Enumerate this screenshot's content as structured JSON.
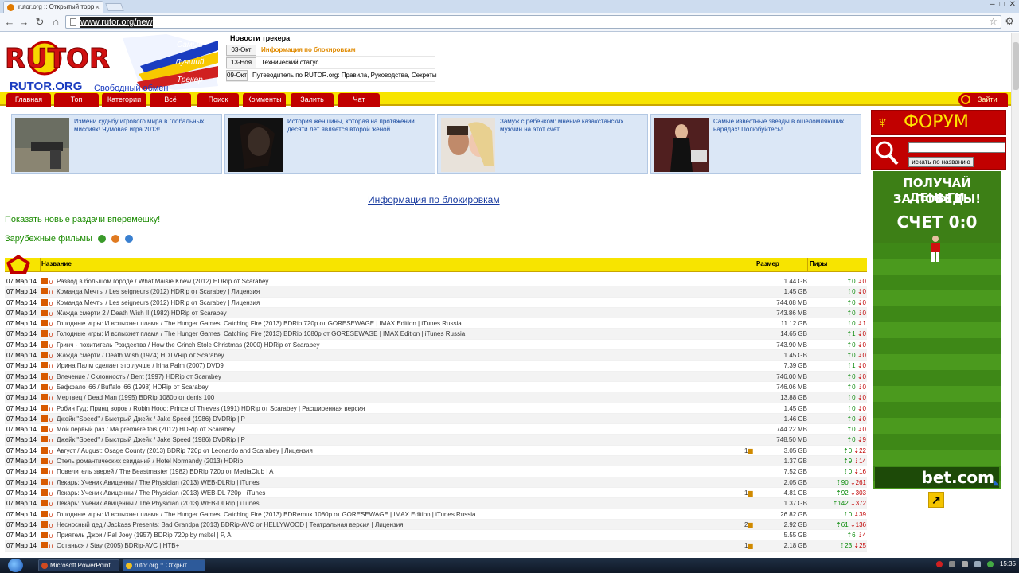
{
  "browser": {
    "tab_title": "rutor.org :: Открытый торр",
    "url": "www.rutor.org/new"
  },
  "logo": {
    "letters": "RUTOR",
    "domain": "RUTOR.ORG",
    "slogan": "Свободный обмен",
    "flag_words": [
      "Самый",
      "Лучший",
      "Трекер"
    ]
  },
  "news": {
    "title": "Новости трекера",
    "items": [
      {
        "date": "03-Окт",
        "text": "Информация по блокировкам",
        "highlight": true
      },
      {
        "date": "13-Ноя",
        "text": "Технический статус",
        "highlight": false
      },
      {
        "date": "09-Окт",
        "text": "Путеводитель по RUTOR.org: Правила, Руководства, Секреты",
        "highlight": false
      }
    ]
  },
  "menu": {
    "items": [
      "Главная",
      "Топ",
      "Категории",
      "Всё",
      "Поиск",
      "Комменты",
      "Залить",
      "Чат"
    ],
    "login": "Зайти"
  },
  "ads": [
    {
      "text": "Измени судьбу игрового мира в глобальных миссиях! Чумовая игра 2013!"
    },
    {
      "text": "История женщины, которая на протяжении десяти лет является второй женой"
    },
    {
      "text": "Замуж с ребенком: мнение казахстанских мужчин на этот счет"
    },
    {
      "text": "Самые известные звёзды в ошеломляющих нарядах! Полюбуйтесь!"
    }
  ],
  "blocking_link": "Информация по блокировкам",
  "show_new": "Показать новые раздачи вперемешку!",
  "section_title": "Зарубежные фильмы",
  "table": {
    "headers": {
      "name": "Название",
      "size": "Размер",
      "peers": "Пиры"
    },
    "rows": [
      {
        "date": "07 Мар 14",
        "title": "Развод в большом городе / What Maisie Knew (2012) HDRip от Scarabey",
        "comments": "",
        "size": "1.44 GB",
        "up": "0",
        "down": "0"
      },
      {
        "date": "07 Мар 14",
        "title": "Команда Мечты / Les seigneurs (2012) HDRip от Scarabey | Лицензия",
        "comments": "",
        "size": "1.45 GB",
        "up": "0",
        "down": "0"
      },
      {
        "date": "07 Мар 14",
        "title": "Команда Мечты / Les seigneurs (2012) HDRip от Scarabey | Лицензия",
        "comments": "",
        "size": "744.08 MB",
        "up": "0",
        "down": "0"
      },
      {
        "date": "07 Мар 14",
        "title": "Жажда смерти 2 / Death Wish II (1982) HDRip от Scarabey",
        "comments": "",
        "size": "743.86 MB",
        "up": "0",
        "down": "0"
      },
      {
        "date": "07 Мар 14",
        "title": "Голодные игры: И вспыхнет пламя / The Hunger Games: Catching Fire (2013) BDRip 720p от GORESEWAGE | IMAX Edition | iTunes Russia",
        "comments": "",
        "size": "11.12 GB",
        "up": "0",
        "down": "1"
      },
      {
        "date": "07 Мар 14",
        "title": "Голодные игры: И вспыхнет пламя / The Hunger Games: Catching Fire (2013) BDRip 1080p от GORESEWAGE | IMAX Edition | iTunes Russia",
        "comments": "",
        "size": "14.65 GB",
        "up": "1",
        "down": "0"
      },
      {
        "date": "07 Мар 14",
        "title": "Гринч - похититель Рождества / How the Grinch Stole Christmas (2000) HDRip от Scarabey",
        "comments": "",
        "size": "743.90 MB",
        "up": "0",
        "down": "0"
      },
      {
        "date": "07 Мар 14",
        "title": "Жажда смерти / Death Wish (1974) HDTVRip от Scarabey",
        "comments": "",
        "size": "1.45 GB",
        "up": "0",
        "down": "0"
      },
      {
        "date": "07 Мар 14",
        "title": "Ирина Палм сделает это лучше / Irina Palm (2007) DVD9",
        "comments": "",
        "size": "7.39 GB",
        "up": "1",
        "down": "0"
      },
      {
        "date": "07 Мар 14",
        "title": "Влечение / Склонность / Bent (1997) HDRip от Scarabey",
        "comments": "",
        "size": "746.00 MB",
        "up": "0",
        "down": "0"
      },
      {
        "date": "07 Мар 14",
        "title": "Баффало '66 / Buffalo '66 (1998) HDRip от Scarabey",
        "comments": "",
        "size": "746.06 MB",
        "up": "0",
        "down": "0"
      },
      {
        "date": "07 Мар 14",
        "title": "Мертвец / Dead Man (1995) BDRip 1080p от denis 100",
        "comments": "",
        "size": "13.88 GB",
        "up": "0",
        "down": "0"
      },
      {
        "date": "07 Мар 14",
        "title": "Робин Гуд: Принц воров / Robin Hood: Prince of Thieves (1991) HDRip от Scarabey | Расширенная версия",
        "comments": "",
        "size": "1.45 GB",
        "up": "0",
        "down": "0"
      },
      {
        "date": "07 Мар 14",
        "title": "Джейк \"Speed\" / Быстрый Джейк / Jake Speed (1986) DVDRip | P",
        "comments": "",
        "size": "1.46 GB",
        "up": "0",
        "down": "0"
      },
      {
        "date": "07 Мар 14",
        "title": "Мой первый раз / Ma première fois (2012) HDRip от Scarabey",
        "comments": "",
        "size": "744.22 MB",
        "up": "0",
        "down": "0"
      },
      {
        "date": "07 Мар 14",
        "title": "Джейк \"Speed\" / Быстрый Джейк / Jake Speed (1986) DVDRip | P",
        "comments": "",
        "size": "748.50 MB",
        "up": "0",
        "down": "9"
      },
      {
        "date": "07 Мар 14",
        "title": "Август / August: Osage County (2013) BDRip 720p от Leonardo and Scarabey | Лицензия",
        "comments": "1",
        "size": "3.05 GB",
        "up": "0",
        "down": "22"
      },
      {
        "date": "07 Мар 14",
        "title": "Отель романтических свиданий / Hotel Normandy (2013) HDRip",
        "comments": "",
        "size": "1.37 GB",
        "up": "9",
        "down": "14"
      },
      {
        "date": "07 Мар 14",
        "title": "Повелитель зверей / The Beastmaster (1982) BDRip 720p от MediaClub | A",
        "comments": "",
        "size": "7.52 GB",
        "up": "0",
        "down": "16"
      },
      {
        "date": "07 Мар 14",
        "title": "Лекарь: Ученик Авиценны / The Physician (2013) WEB-DLRip | iTunes",
        "comments": "",
        "size": "2.05 GB",
        "up": "90",
        "down": "261"
      },
      {
        "date": "07 Мар 14",
        "title": "Лекарь: Ученик Авиценны / The Physician (2013) WEB-DL 720p | iTunes",
        "comments": "1",
        "size": "4.81 GB",
        "up": "92",
        "down": "303"
      },
      {
        "date": "07 Мар 14",
        "title": "Лекарь: Ученик Авиценны / The Physician (2013) WEB-DLRip | iTunes",
        "comments": "",
        "size": "1.37 GB",
        "up": "142",
        "down": "372"
      },
      {
        "date": "07 Мар 14",
        "title": "Голодные игры: И вспыхнет пламя / The Hunger Games: Catching Fire (2013) BDRemux 1080p от GORESEWAGE | IMAX Edition | iTunes Russia",
        "comments": "",
        "size": "26.82 GB",
        "up": "0",
        "down": "39"
      },
      {
        "date": "07 Мар 14",
        "title": "Несносный дед / Jackass Presents: Bad Grandpa (2013) BDRip-AVC от HELLYWOOD | Театральная версия | Лицензия",
        "comments": "2",
        "size": "2.92 GB",
        "up": "61",
        "down": "136"
      },
      {
        "date": "07 Мар 14",
        "title": "Приятель Джои / Pal Joey (1957) BDRip 720p by msltel | P, A",
        "comments": "",
        "size": "5.55 GB",
        "up": "6",
        "down": "4"
      },
      {
        "date": "07 Мар 14",
        "title": "Останься / Stay (2005) BDRip-AVC | НТВ+",
        "comments": "1",
        "size": "2.18 GB",
        "up": "23",
        "down": "25"
      }
    ]
  },
  "sidebar": {
    "forum_label": "ФОРУМ",
    "search_placeholder": "",
    "search_button": "искать по названию",
    "banner_line1": "ПОЛУЧАЙ ДЕНЬГИ",
    "banner_line2": "ЗА ПОБЕДЫ!",
    "banner_score": "СЧЕТ 0:0",
    "banner_brand": "bet.com"
  },
  "taskbar": {
    "tasks": [
      "Microsoft PowerPoint ...",
      "rutor.org :: Открыт..."
    ],
    "clock": "15:35"
  },
  "colors": {
    "menu_red": "#c10000",
    "menu_yellow": "#f7e400",
    "link_green": "#1a8a00",
    "news_orange": "#e08a00"
  }
}
